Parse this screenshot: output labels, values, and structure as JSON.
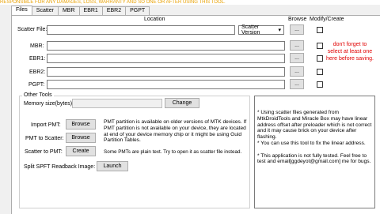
{
  "banner": "RESPONSIBLE FOR ANY DAMAGES, LOSS, WARRANTY AND SO ONE OR AFTER USING THIS TOOL.",
  "tabs": [
    "Files",
    "Scatter",
    "MBR",
    "EBR1",
    "EBR2",
    "PGPT"
  ],
  "headers": {
    "location": "Location",
    "browse": "Browse",
    "modify": "Modify/Create"
  },
  "rows": [
    {
      "label": "Scatter File:",
      "value": "",
      "browse": "...",
      "checked": false
    },
    {
      "label": "MBR:",
      "value": "",
      "browse": "...",
      "checked": false
    },
    {
      "label": "EBR1:",
      "value": "",
      "browse": "...",
      "checked": false
    },
    {
      "label": "EBR2:",
      "value": "",
      "browse": "...",
      "checked": false
    },
    {
      "label": "PGPT:",
      "value": "",
      "browse": "...",
      "checked": false
    }
  ],
  "scatter_version": {
    "selected": "Scatter Version"
  },
  "warning": "don't forget to select at least one here before saving.",
  "other_tools": {
    "title": "Other Tools",
    "memory_label": "Memory size(bytes):",
    "memory_value": "",
    "change_button": "Change",
    "import_pmt_label": "Import PMT:",
    "import_pmt_button": "Browse",
    "import_pmt_desc": "PMT partition is available on older versions of MTK devices. If PMT partition is not available on your device, they are located at end of your device memory chip or it might be using Guid Partition Tables.",
    "pmt_to_scatter_label": "PMT to Scatter:",
    "pmt_to_scatter_button": "Browse",
    "scatter_to_pmt_label": "Scatter to PMT:",
    "scatter_to_pmt_button": "Create",
    "scatter_to_pmt_desc": "Some PMTs are plain text.  Try to open it as scatter file instead.",
    "split_label": "Split SPFT Readback Image:",
    "split_button": "Launch"
  },
  "notes": "* Using scatter files generated from MtkDroidTools and Miracle Box may have linear address offset after preloader which is not correct and it may cause brick on your device after flashing.\n* You can use this tool to fix the linear address.\n\n* This application is not fully tested. Feel free to test and email[ggdeyot@gmail.com] me for bugs."
}
